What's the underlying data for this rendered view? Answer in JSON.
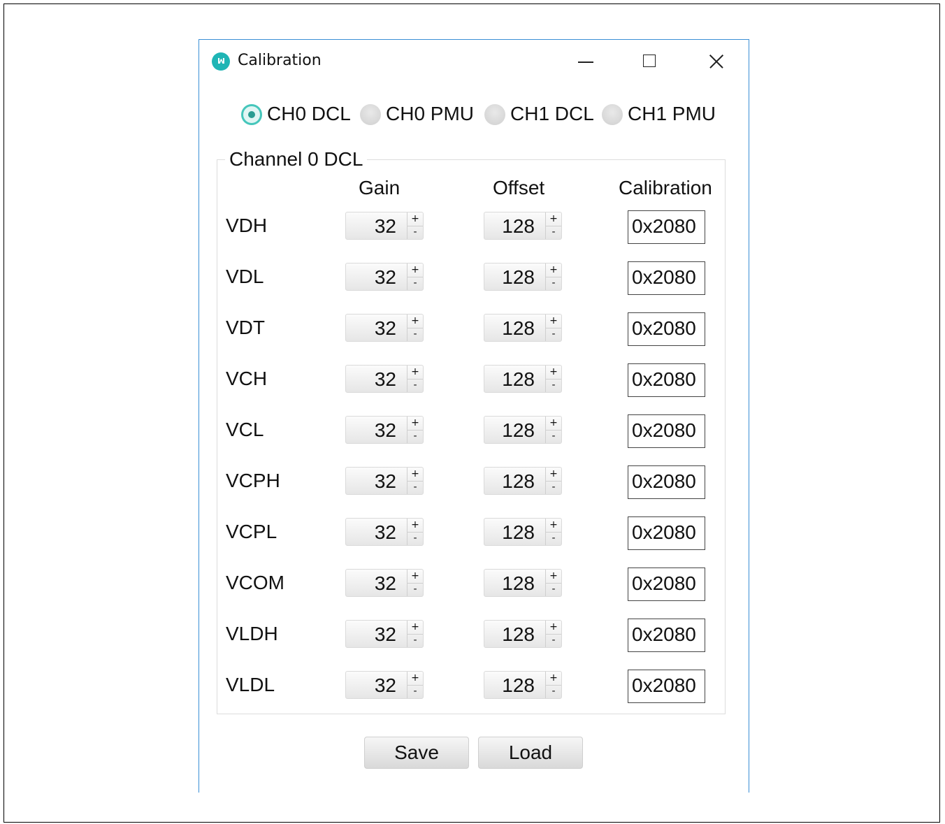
{
  "window": {
    "title": "Calibration",
    "logo_text": "ꟽ",
    "accent_color": "#3a8fd6",
    "logo_color": "#1fb5b5",
    "controls": [
      "minimize-icon",
      "maximize-icon",
      "close-icon"
    ]
  },
  "channel_select": {
    "selected": "CH0 DCL",
    "options": [
      {
        "label": "CH0 DCL",
        "checked": true
      },
      {
        "label": "CH0 PMU",
        "checked": false
      },
      {
        "label": "CH1 DCL",
        "checked": false
      },
      {
        "label": "CH1 PMU",
        "checked": false
      }
    ]
  },
  "group": {
    "title": "Channel 0 DCL",
    "columns": {
      "gain": "Gain",
      "offset": "Offset",
      "calibration": "Calibration"
    },
    "rows": [
      {
        "label": "VDH",
        "gain": "32",
        "offset": "128",
        "calibration": "0x2080"
      },
      {
        "label": "VDL",
        "gain": "32",
        "offset": "128",
        "calibration": "0x2080"
      },
      {
        "label": "VDT",
        "gain": "32",
        "offset": "128",
        "calibration": "0x2080"
      },
      {
        "label": "VCH",
        "gain": "32",
        "offset": "128",
        "calibration": "0x2080"
      },
      {
        "label": "VCL",
        "gain": "32",
        "offset": "128",
        "calibration": "0x2080"
      },
      {
        "label": "VCPH",
        "gain": "32",
        "offset": "128",
        "calibration": "0x2080"
      },
      {
        "label": "VCPL",
        "gain": "32",
        "offset": "128",
        "calibration": "0x2080"
      },
      {
        "label": "VCOM",
        "gain": "32",
        "offset": "128",
        "calibration": "0x2080"
      },
      {
        "label": "VLDH",
        "gain": "32",
        "offset": "128",
        "calibration": "0x2080"
      },
      {
        "label": "VLDL",
        "gain": "32",
        "offset": "128",
        "calibration": "0x2080"
      }
    ],
    "spinner_symbols": {
      "up": "+",
      "down": "-"
    }
  },
  "actions": {
    "save_label": "Save",
    "load_label": "Load"
  }
}
